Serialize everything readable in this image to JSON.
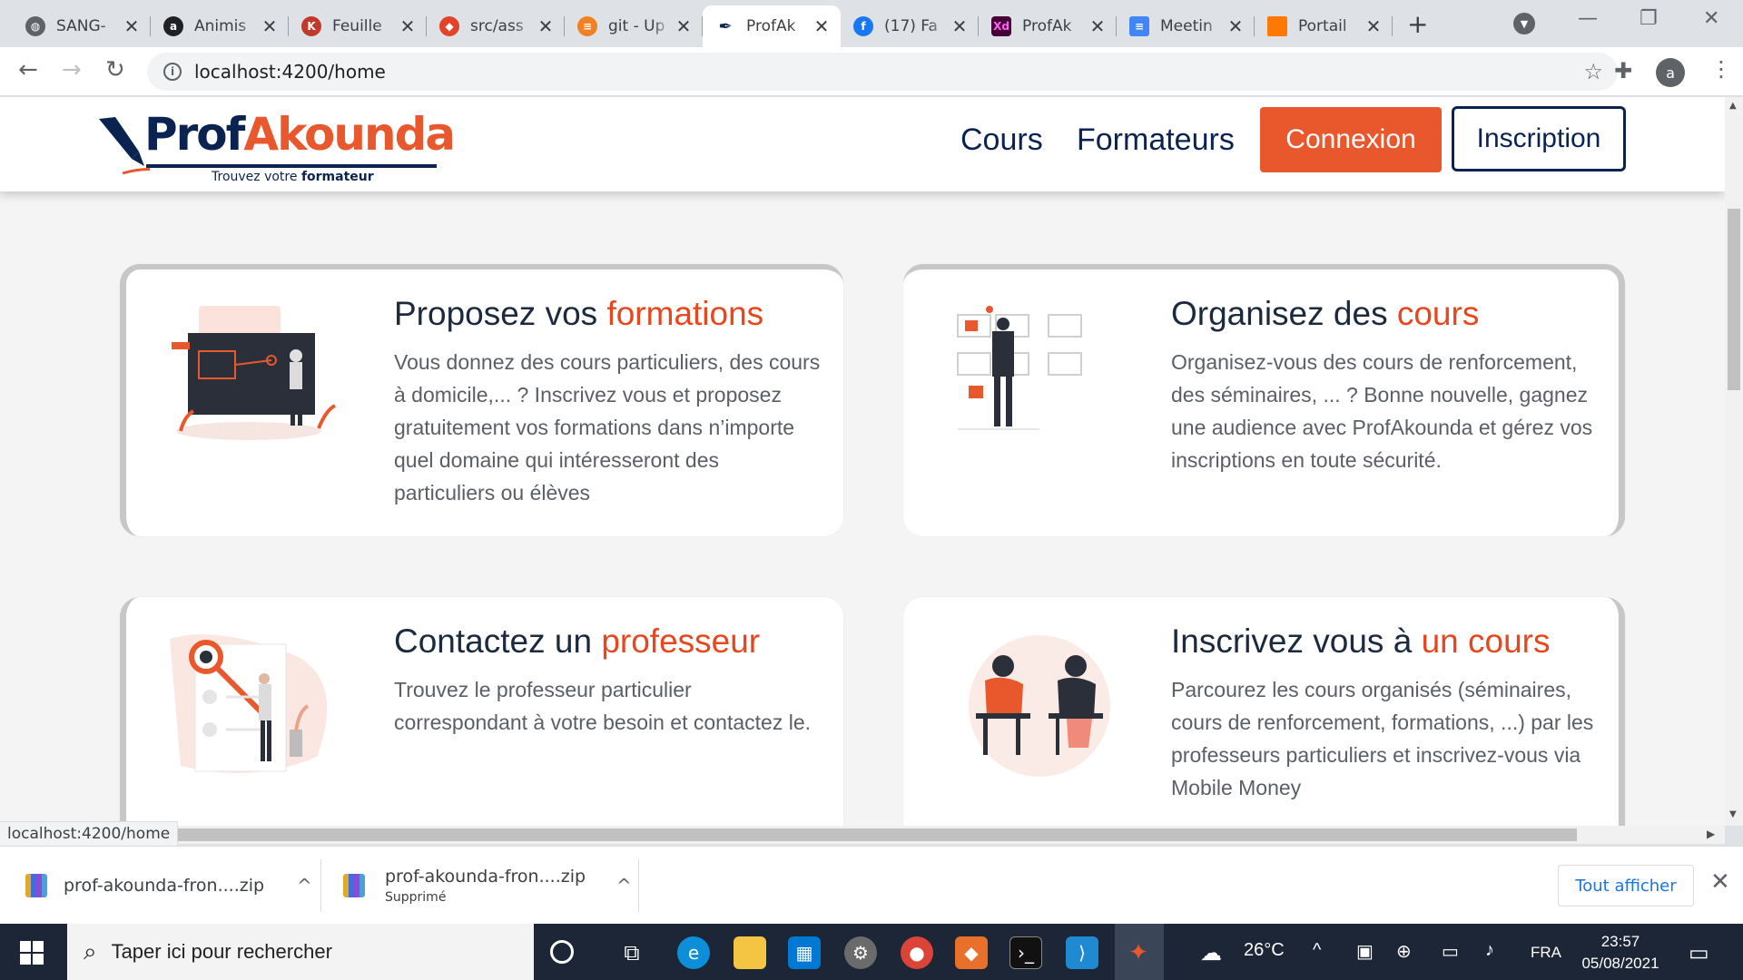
{
  "browser": {
    "tabs": [
      {
        "title": "SANG-",
        "icon": "globe-icon",
        "color": "#5f6368"
      },
      {
        "title": "Animis",
        "icon": "a-letter-icon",
        "color": "#202124"
      },
      {
        "title": "Feuille",
        "icon": "k-badge-icon",
        "color": "#c0392b"
      },
      {
        "title": "src/ass",
        "icon": "gitlab-icon",
        "color": "#e2432a"
      },
      {
        "title": "git - Up",
        "icon": "stackoverflow-icon",
        "color": "#f48024"
      },
      {
        "title": "ProfAk",
        "icon": "pen-icon",
        "color": "#0a2350"
      },
      {
        "title": "(17) Fa",
        "icon": "facebook-icon",
        "color": "#1877f2"
      },
      {
        "title": "ProfAk",
        "icon": "adobe-xd-icon",
        "color": "#470137"
      },
      {
        "title": "Meetin",
        "icon": "google-docs-icon",
        "color": "#4285f4"
      },
      {
        "title": "Portail",
        "icon": "orange-icon",
        "color": "#ff7900"
      }
    ],
    "address": "localhost:4200/home",
    "profile_initial": "a",
    "status_url": "localhost:4200/home"
  },
  "site": {
    "logo": {
      "part1": "Prof",
      "part2": "Akounda",
      "tagline_plain": "Trouvez votre ",
      "tagline_bold": "formateur"
    },
    "nav": {
      "courses": "Cours",
      "trainers": "Formateurs",
      "login": "Connexion",
      "signup": "Inscription"
    },
    "colors": {
      "brand_navy": "#0a2350",
      "brand_orange": "#e8582c"
    },
    "cards": [
      {
        "title": "Proposez vos ",
        "accent": "formations",
        "text": "Vous donnez des cours particuliers, des cours à domicile,... ? Inscrivez vous et proposez gratuitement vos formations dans n’importe quel domaine qui intéresseront des particuliers ou élèves"
      },
      {
        "title": "Organisez des ",
        "accent": "cours",
        "text": "Organisez-vous des cours de renforcement, des séminaires, ... ? Bonne nouvelle, gagnez une audience avec ProfAkounda et gérez vos inscriptions en toute sécurité."
      },
      {
        "title": "Contactez un ",
        "accent": "professeur",
        "text": "Trouvez le professeur particulier correspondant à votre besoin et contactez le."
      },
      {
        "title": "Inscrivez vous à ",
        "accent": "un cours",
        "text": "Parcourez les cours organisés (séminaires, cours de renforcement, formations, ...) par les professeurs particuliers et inscrivez-vous via Mobile Money"
      }
    ]
  },
  "downloads": {
    "items": [
      {
        "name": "prof-akounda-fron....zip",
        "status": ""
      },
      {
        "name": "prof-akounda-fron....zip",
        "status": "Supprimé"
      }
    ],
    "show_all": "Tout afficher"
  },
  "taskbar": {
    "search_placeholder": "Taper ici pour rechercher",
    "weather": "26°C",
    "language": "FRA",
    "time": "23:57",
    "date": "05/08/2021"
  }
}
